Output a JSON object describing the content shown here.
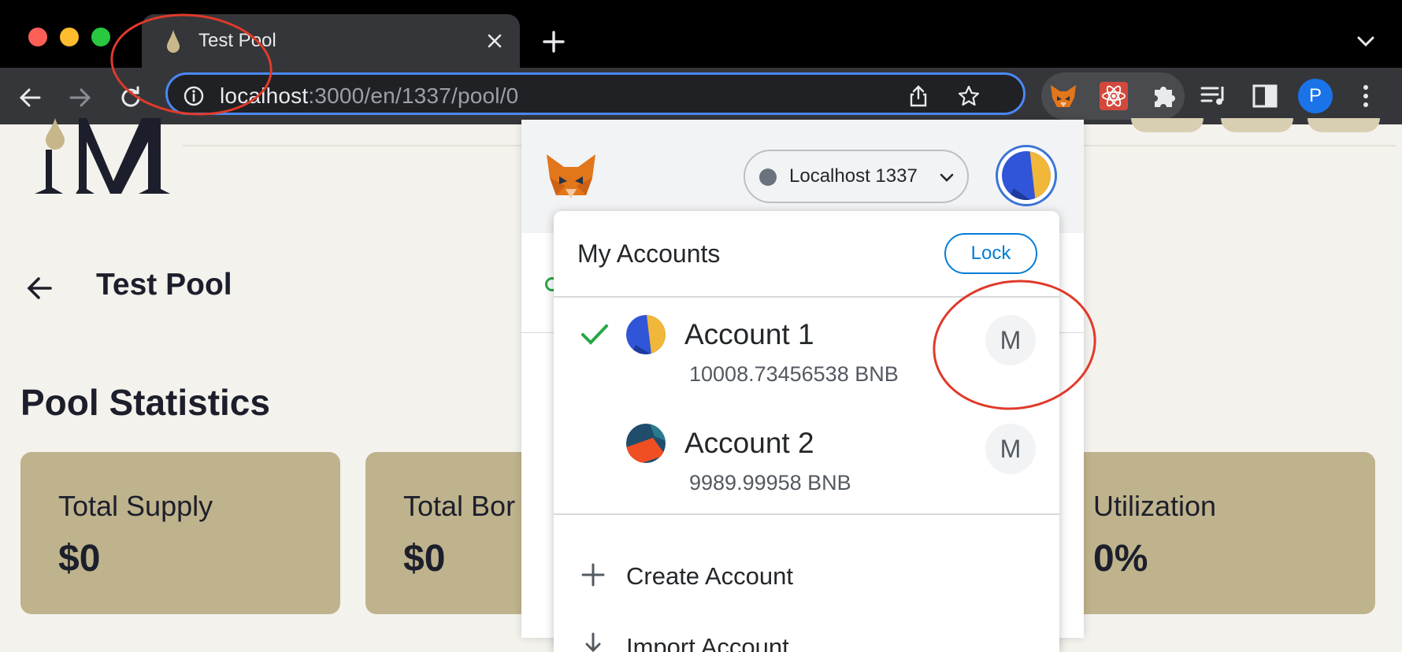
{
  "browser": {
    "tab_title": "Test Pool",
    "url_host": "localhost",
    "url_rest": ":3000/en/1337/pool/0",
    "profile_initial": "P"
  },
  "page": {
    "title": "Test Pool",
    "section_title": "Pool Statistics",
    "stats": [
      {
        "label": "Total Supply",
        "value": "$0"
      },
      {
        "label": "Total Bor",
        "value": "$0"
      },
      {
        "label": "Utilization",
        "value": "0%"
      }
    ]
  },
  "metamask": {
    "network_label": "Localhost 1337",
    "menu_title": "My Accounts",
    "lock_label": "Lock",
    "accounts": [
      {
        "name": "Account 1",
        "balance": "10008.73456538 BNB",
        "badge": "M",
        "selected": true
      },
      {
        "name": "Account 2",
        "balance": "9989.99958 BNB",
        "badge": "M",
        "selected": false
      }
    ],
    "create_label": "Create Account",
    "import_label": "Import Account"
  },
  "colors": {
    "card": "#bfb38d",
    "accent_blue": "#037dd6",
    "annotation_red": "#e03a2a",
    "check_green": "#28a745"
  }
}
